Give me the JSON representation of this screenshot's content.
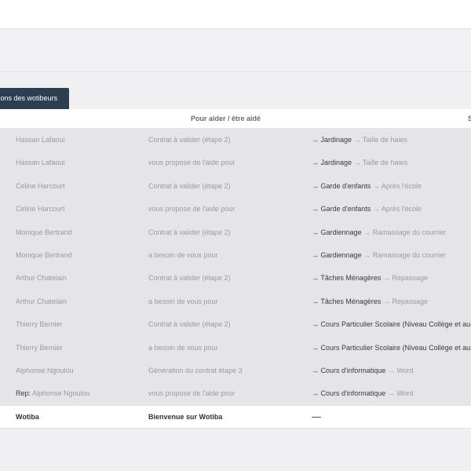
{
  "tabs": {
    "active_label": "ations des wotibeurs"
  },
  "table": {
    "headers": {
      "help": "Pour aider / être aidé",
      "right_partial": "S"
    },
    "rows": [
      {
        "prefix": "",
        "name": "Hassan Lafaoui",
        "status": "Contrat à valider (étape 2)",
        "category": "Jardinage",
        "service": "Taille de haies"
      },
      {
        "prefix": "",
        "name": "Hassan Lafaoui",
        "status": "vous propose de l'aide pour",
        "category": "Jardinage",
        "service": "Taille de haies"
      },
      {
        "prefix": "",
        "name": "Celine Harcourt",
        "status": "Contrat à valider (étape 2)",
        "category": "Garde d'enfants",
        "service": "Après l'école"
      },
      {
        "prefix": "",
        "name": "Celine Harcourt",
        "status": "vous propose de l'aide pour",
        "category": "Garde d'enfants",
        "service": "Après l'école"
      },
      {
        "prefix": "",
        "name": "Monique Bertrand",
        "status": "Contrat à valider (étape 2)",
        "category": "Gardiennage",
        "service": "Ramassage du courrier"
      },
      {
        "prefix": "",
        "name": "Monique Bertrand",
        "status": "a besoin de vous pour",
        "category": "Gardiennage",
        "service": "Ramassage du courrier"
      },
      {
        "prefix": "",
        "name": "Arthur Chatelain",
        "status": "Contrat à valider (étape 2)",
        "category": "Tâches Ménagères",
        "service": "Repassage"
      },
      {
        "prefix": "",
        "name": "Arthur Chatelain",
        "status": "a besoin de vous pour",
        "category": "Tâches Ménagères",
        "service": "Repassage"
      },
      {
        "prefix": "",
        "name": "Thierry Bernier",
        "status": "Contrat à valider (étape 2)",
        "category": "Cours Particulier Scolaire (Niveau Collège et au-de",
        "service": ""
      },
      {
        "prefix": "",
        "name": "Thierry Bernier",
        "status": "a besoin de vous pour",
        "category": "Cours Particulier Scolaire (Niveau Collège et au-de",
        "service": ""
      },
      {
        "prefix": "",
        "name": "Alphonse Ngoulou",
        "status": "Génération du contrat étape 3",
        "category": "Cours d'informatique",
        "service": "Word"
      },
      {
        "prefix": "Rep:",
        "name": "Alphonse Ngoulou",
        "status": "vous propose de l'aide pour",
        "category": "Cours d'informatique",
        "service": "Word"
      }
    ],
    "footer": {
      "name": "Wotiba",
      "status": "Bienvenue sur Wotiba",
      "category": "----"
    }
  },
  "arrow": "→",
  "colors": {
    "tab_bg": "#2d3e50",
    "row_bg": "#e5e5e8",
    "page_bg": "#f0f0f2"
  }
}
